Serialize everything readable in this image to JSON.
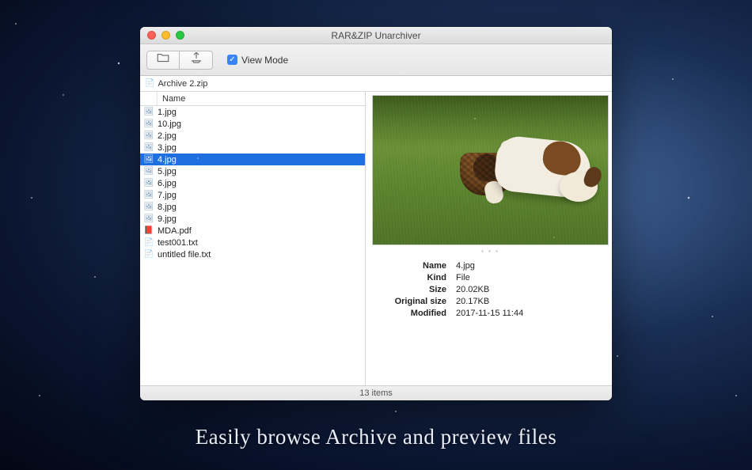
{
  "caption": "Easily browse Archive and preview files",
  "window": {
    "title": "RAR&ZIP Unarchiver"
  },
  "toolbar": {
    "view_mode_label": "View Mode",
    "view_mode_checked": true
  },
  "breadcrumb": {
    "archive_name": "Archive 2.zip"
  },
  "columns": {
    "name": "Name"
  },
  "files": [
    {
      "name": "1.jpg",
      "type": "image"
    },
    {
      "name": "10.jpg",
      "type": "image"
    },
    {
      "name": "2.jpg",
      "type": "image"
    },
    {
      "name": "3.jpg",
      "type": "image"
    },
    {
      "name": "4.jpg",
      "type": "image",
      "selected": true
    },
    {
      "name": "5.jpg",
      "type": "image"
    },
    {
      "name": "6.jpg",
      "type": "image"
    },
    {
      "name": "7.jpg",
      "type": "image"
    },
    {
      "name": "8.jpg",
      "type": "image"
    },
    {
      "name": "9.jpg",
      "type": "image"
    },
    {
      "name": "MDA.pdf",
      "type": "pdf"
    },
    {
      "name": "test001.txt",
      "type": "text"
    },
    {
      "name": "untitled file.txt",
      "type": "text"
    }
  ],
  "details": {
    "labels": {
      "name": "Name",
      "kind": "Kind",
      "size": "Size",
      "original_size": "Original size",
      "modified": "Modified"
    },
    "values": {
      "name": "4.jpg",
      "kind": "File",
      "size": "20.02KB",
      "original_size": "20.17KB",
      "modified": "2017-11-15 11:44"
    }
  },
  "status": {
    "text": "13 items"
  }
}
